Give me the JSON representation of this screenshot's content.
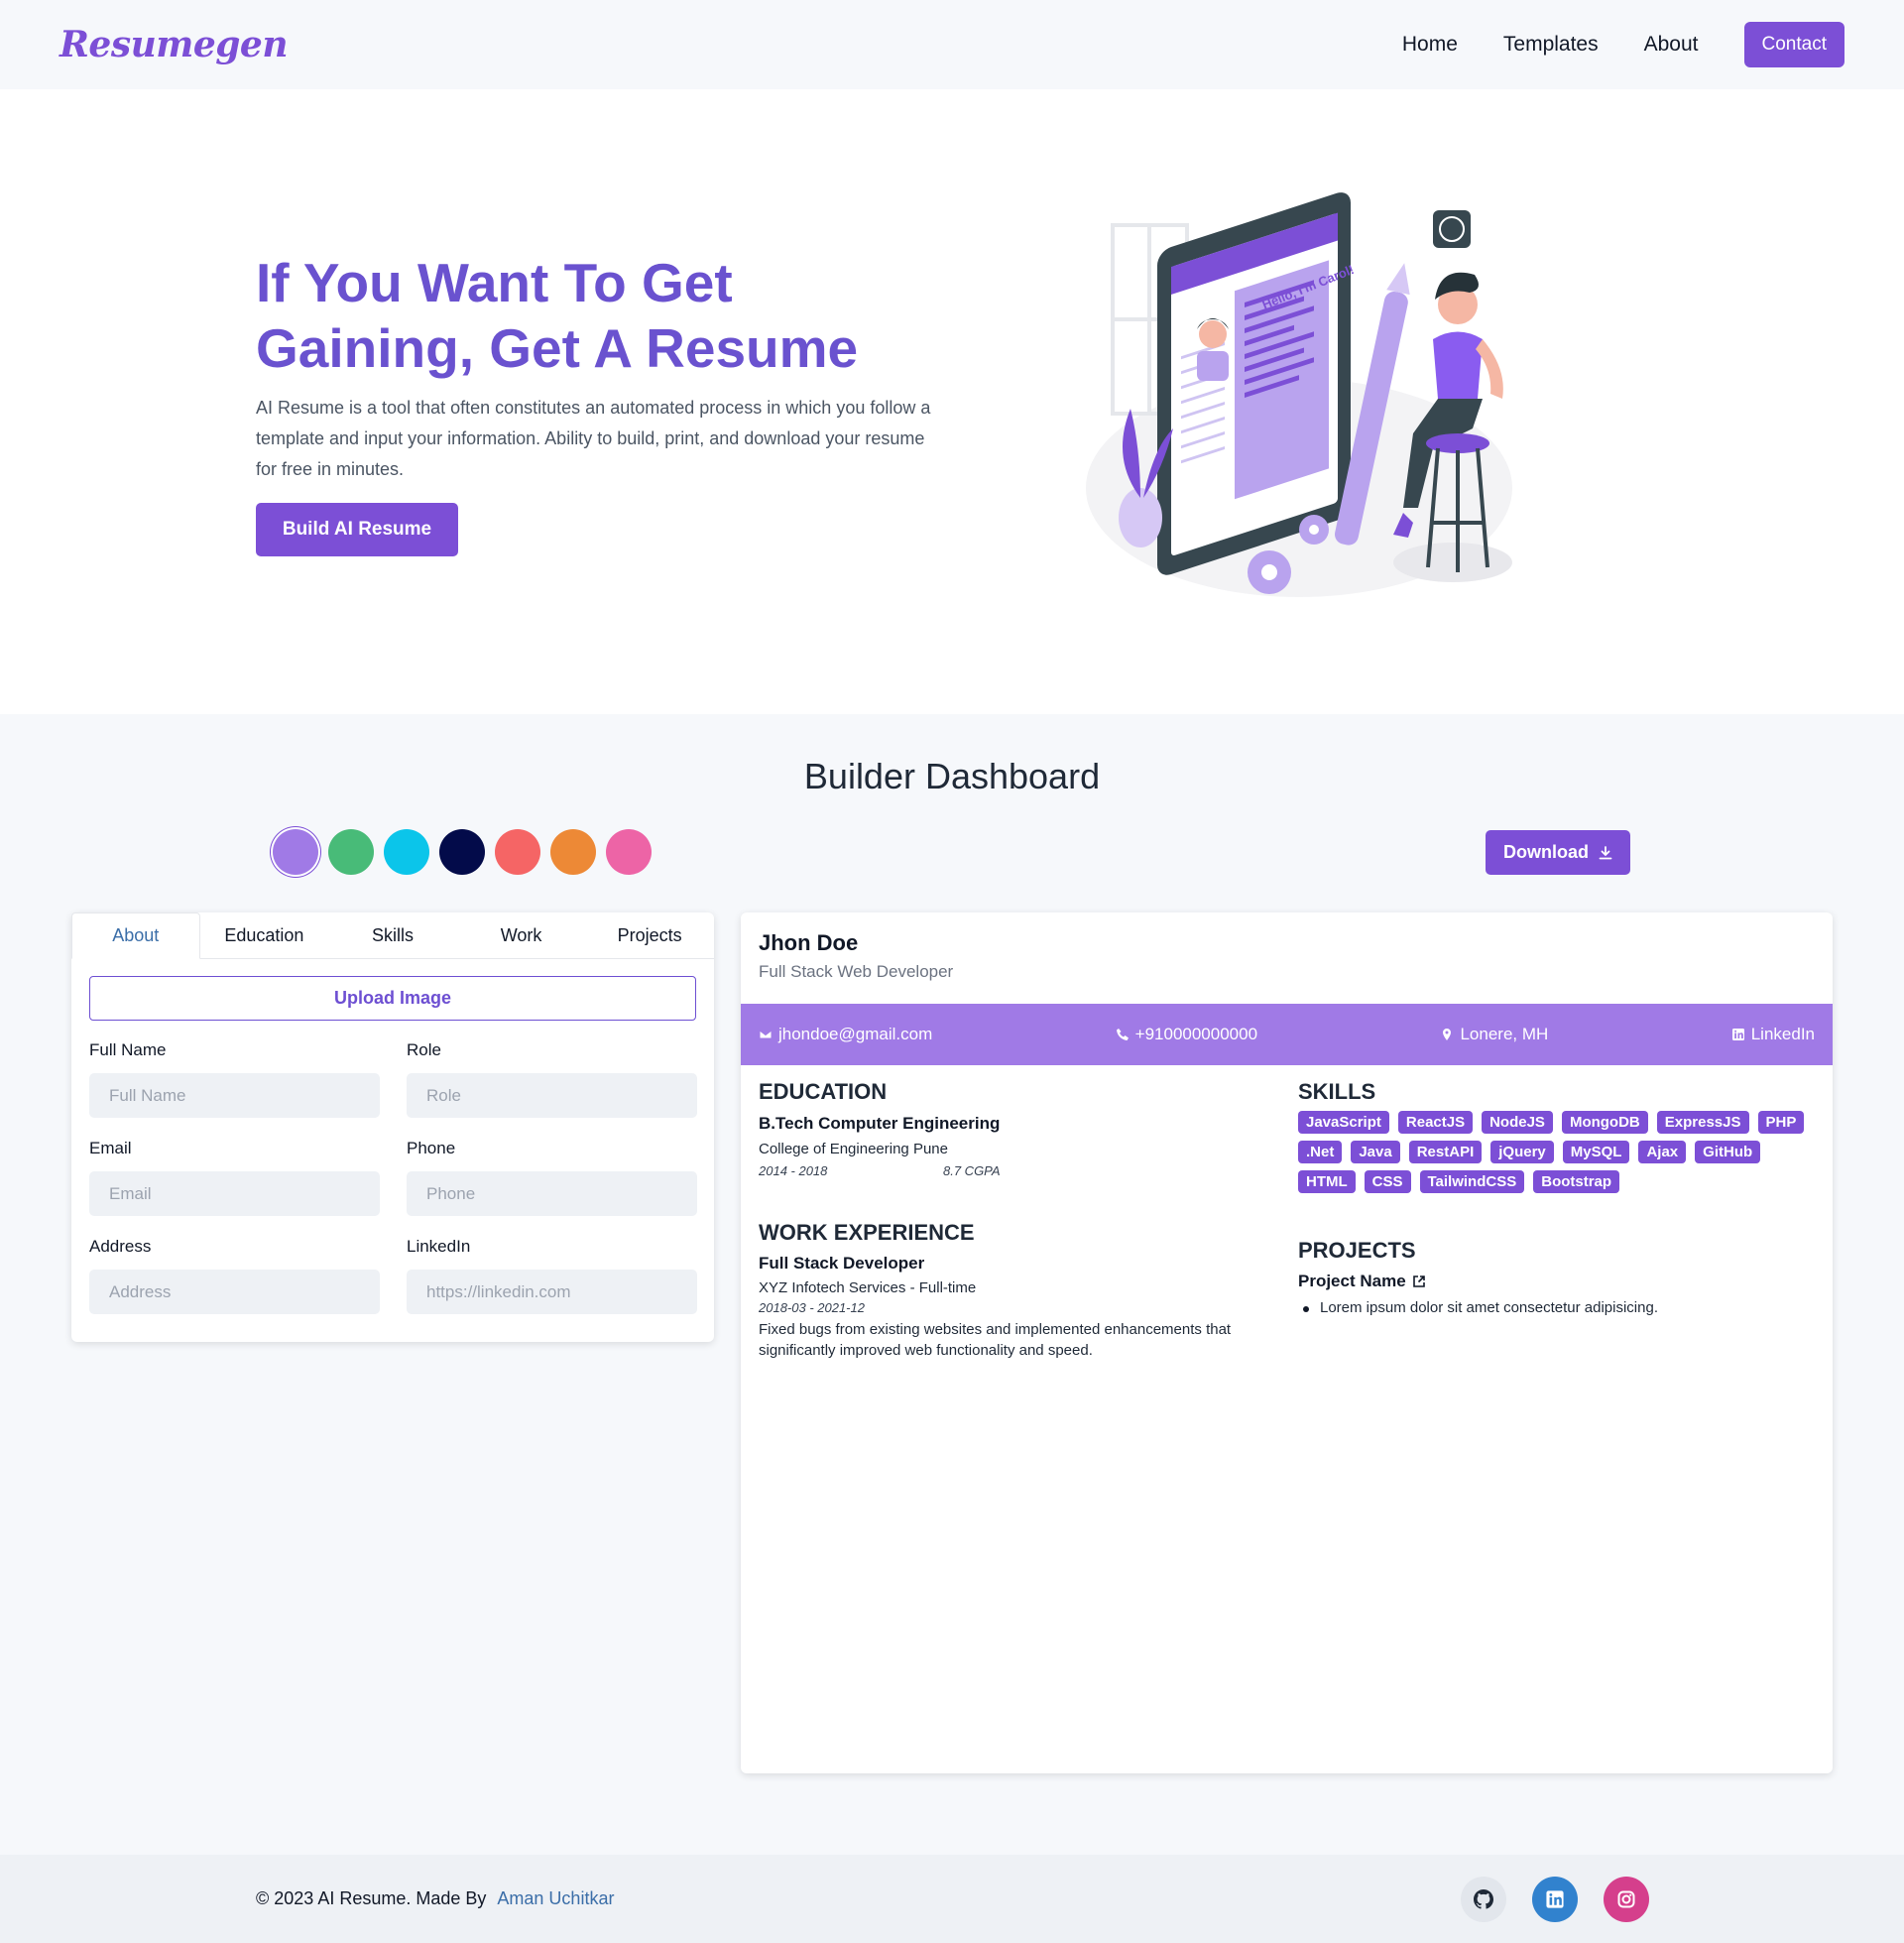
{
  "nav": {
    "logo": "Resumegen",
    "links": [
      "Home",
      "Templates",
      "About"
    ],
    "contact": "Contact"
  },
  "hero": {
    "title": "If You Want To Get Gaining, Get A Resume",
    "description": "AI Resume is a tool that often constitutes an automated process in which you follow a template and input your information. Ability to build, print, and download your resume for free in minutes.",
    "button": "Build AI Resume",
    "illustration_text": "Hello, I'm Carol!"
  },
  "dashboard": {
    "title": "Builder Dashboard",
    "colors": [
      "#a07ae6",
      "#48bb78",
      "#0bc5ea",
      "#030b4a",
      "#f56565",
      "#ed8936",
      "#ed64a6"
    ],
    "download": "Download"
  },
  "form": {
    "tabs": [
      "About",
      "Education",
      "Skills",
      "Work",
      "Projects"
    ],
    "upload": "Upload Image",
    "fields": {
      "full_name": {
        "label": "Full Name",
        "placeholder": "Full Name"
      },
      "role": {
        "label": "Role",
        "placeholder": "Role"
      },
      "email": {
        "label": "Email",
        "placeholder": "Email"
      },
      "phone": {
        "label": "Phone",
        "placeholder": "Phone"
      },
      "address": {
        "label": "Address",
        "placeholder": "Address"
      },
      "linkedin": {
        "label": "LinkedIn",
        "placeholder": "https://linkedin.com"
      }
    }
  },
  "resume": {
    "name": "Jhon Doe",
    "role": "Full Stack Web Developer",
    "email": "jhondoe@gmail.com",
    "phone": "+910000000000",
    "location": "Lonere, MH",
    "linkedin": "LinkedIn",
    "education_heading": "EDUCATION",
    "degree": "B.Tech Computer Engineering",
    "college": "College of Engineering Pune",
    "edu_years": "2014 - 2018",
    "cgpa": "8.7 CGPA",
    "work_heading": "WORK EXPERIENCE",
    "job_title": "Full Stack Developer",
    "company": "XYZ Infotech Services - Full-time",
    "job_dates": "2018-03 - 2021-12",
    "job_desc": "Fixed bugs from existing websites and implemented enhancements that significantly improved web functionality and speed.",
    "skills_heading": "SKILLS",
    "skills": [
      "JavaScript",
      "ReactJS",
      "NodeJS",
      "MongoDB",
      "ExpressJS",
      "PHP",
      ".Net",
      "Java",
      "RestAPI",
      "jQuery",
      "MySQL",
      "Ajax",
      "GitHub",
      "HTML",
      "CSS",
      "TailwindCSS",
      "Bootstrap"
    ],
    "projects_heading": "PROJECTS",
    "project_name": "Project Name",
    "project_desc": "Lorem ipsum dolor sit amet consectetur adipisicing."
  },
  "footer": {
    "text": "© 2023 AI Resume. Made By",
    "author": "Aman Uchitkar",
    "social": [
      "github-icon",
      "linkedin-icon",
      "instagram-icon"
    ]
  }
}
